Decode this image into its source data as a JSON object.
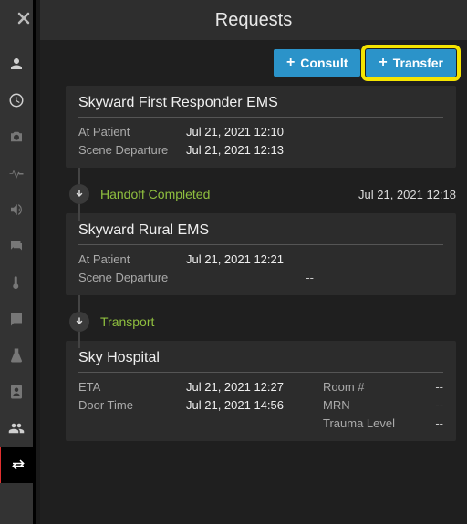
{
  "header": {
    "title": "Requests"
  },
  "actions": {
    "consult_label": "Consult",
    "transfer_label": "Transfer"
  },
  "colors": {
    "accent": "#2b93c9",
    "highlight": "#f5e400",
    "success": "#8fbf3f"
  },
  "cards": [
    {
      "title": "Skyward First Responder EMS",
      "rows": [
        {
          "label": "At Patient",
          "value": "Jul 21, 2021 12:10"
        },
        {
          "label": "Scene Departure",
          "value": "Jul 21, 2021 12:13"
        }
      ]
    },
    {
      "title": "Skyward Rural EMS",
      "rows": [
        {
          "label": "At Patient",
          "value": "Jul 21, 2021 12:21"
        },
        {
          "label": "Scene Departure",
          "value": "--"
        }
      ]
    },
    {
      "title": "Sky Hospital",
      "rows": [
        {
          "label": "ETA",
          "value": "Jul 21, 2021 12:27",
          "label2": "Room #",
          "value2": "--"
        },
        {
          "label": "Door Time",
          "value": "Jul 21, 2021 14:56",
          "label2": "MRN",
          "value2": "--"
        },
        {
          "label": "",
          "value": "",
          "label2": "Trauma Level",
          "value2": "--"
        }
      ]
    }
  ],
  "timeline": [
    {
      "label": "Handoff Completed",
      "time": "Jul 21, 2021 12:18"
    },
    {
      "label": "Transport",
      "time": ""
    }
  ]
}
